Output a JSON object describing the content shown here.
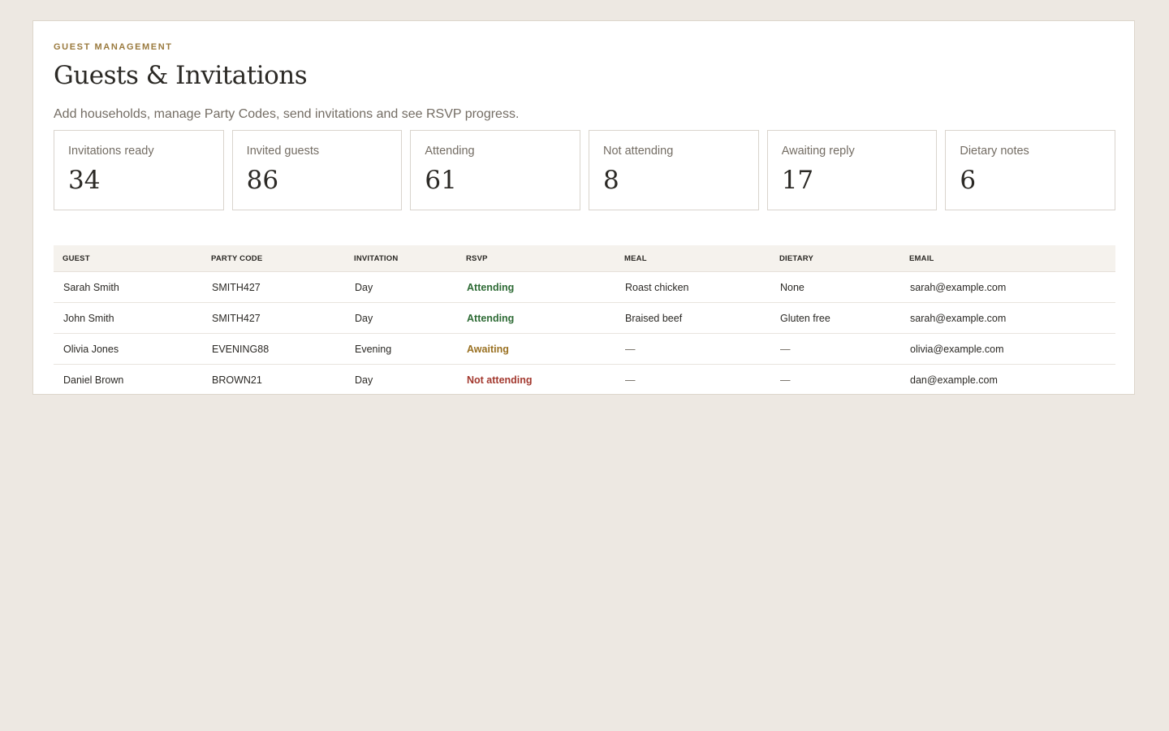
{
  "header": {
    "eyebrow": "GUEST MANAGEMENT",
    "title": "Guests & Invitations",
    "subtitle": "Add households, manage Party Codes, send invitations and see RSVP progress."
  },
  "stats": [
    {
      "label": "Invitations ready",
      "value": "34"
    },
    {
      "label": "Invited guests",
      "value": "86"
    },
    {
      "label": "Attending",
      "value": "61"
    },
    {
      "label": "Not attending",
      "value": "8"
    },
    {
      "label": "Awaiting reply",
      "value": "17"
    },
    {
      "label": "Dietary notes",
      "value": "6"
    }
  ],
  "table": {
    "columns": [
      "GUEST",
      "PARTY CODE",
      "INVITATION",
      "RSVP",
      "MEAL",
      "DIETARY",
      "EMAIL"
    ],
    "rows": [
      {
        "guest": "Sarah Smith",
        "party_code": "SMITH427",
        "invitation": "Day",
        "rsvp": "Attending",
        "meal": "Roast chicken",
        "dietary": "None",
        "email": "sarah@example.com"
      },
      {
        "guest": "John Smith",
        "party_code": "SMITH427",
        "invitation": "Day",
        "rsvp": "Attending",
        "meal": "Braised beef",
        "dietary": "Gluten free",
        "email": "sarah@example.com"
      },
      {
        "guest": "Olivia Jones",
        "party_code": "EVENING88",
        "invitation": "Evening",
        "rsvp": "Awaiting",
        "meal": "—",
        "dietary": "—",
        "email": "olivia@example.com"
      },
      {
        "guest": "Daniel Brown",
        "party_code": "BROWN21",
        "invitation": "Day",
        "rsvp": "Not attending",
        "meal": "—",
        "dietary": "—",
        "email": "dan@example.com"
      }
    ]
  },
  "colors": {
    "background": "#ede8e2",
    "accent": "#9a7a3e",
    "attending": "#2e6b35",
    "awaiting": "#9a7122",
    "not_attending": "#a3392f"
  }
}
